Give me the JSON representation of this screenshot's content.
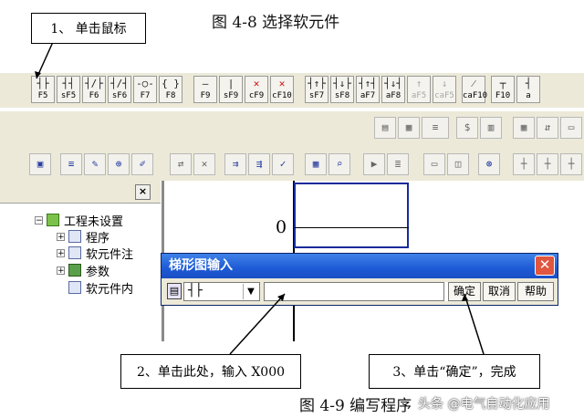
{
  "captions": {
    "top": "图 4-8 选择软元件",
    "bottom": "图 4-9  编写程序"
  },
  "callouts": {
    "one": "1、  单击鼠标",
    "two": "2、单击此处，输入 X000",
    "three": "3、单击“确定”，完成"
  },
  "toolbar_keys": [
    {
      "sym": "┤├",
      "label": "F5"
    },
    {
      "sym": "┤┤",
      "label": "sF5"
    },
    {
      "sym": "┤/├",
      "label": "F6"
    },
    {
      "sym": "┤/┤",
      "label": "sF6"
    },
    {
      "sym": "-○-",
      "label": "F7"
    },
    {
      "sym": "{ }",
      "label": "F8"
    },
    {
      "sym": "—",
      "label": "F9"
    },
    {
      "sym": "|",
      "label": "sF9"
    },
    {
      "sym": "✕",
      "label": "cF9"
    },
    {
      "sym": "✕",
      "label": "cF10"
    },
    {
      "sym": "┤↑├",
      "label": "sF7"
    },
    {
      "sym": "┤↓├",
      "label": "sF8"
    },
    {
      "sym": "┤↑┤",
      "label": "aF7"
    },
    {
      "sym": "┤↓┤",
      "label": "aF8"
    },
    {
      "sym": "↑",
      "label": "aF5"
    },
    {
      "sym": "↓",
      "label": "caF5"
    },
    {
      "sym": "⁄",
      "label": "caF10"
    },
    {
      "sym": "┬",
      "label": "F10"
    },
    {
      "sym": "┤",
      "label": "a"
    }
  ],
  "tree": {
    "root": "工程未设置",
    "items": [
      "程序",
      "软元件注",
      "参数",
      "软元件内"
    ]
  },
  "ladder": {
    "step": "0"
  },
  "dialog": {
    "title": "梯形图输入",
    "type_value": "┤├",
    "input_value": "",
    "ok": "确定",
    "cancel": "取消",
    "help": "帮助"
  },
  "watermark": "头条 @电气自动化应用",
  "colors": {
    "titlebar": "#1d5ad6",
    "cursor_box": "#1a2a9a",
    "toolbar_bg": "#ece9d8"
  }
}
